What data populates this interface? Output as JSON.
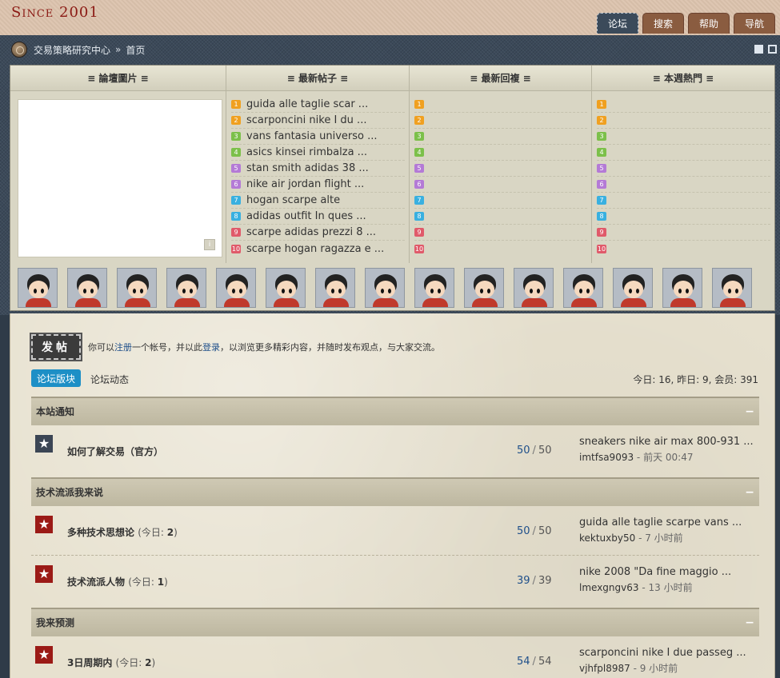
{
  "header": {
    "logo": "Since 2001",
    "nav": [
      "论坛",
      "搜索",
      "帮助",
      "导航"
    ]
  },
  "breadcrumb": {
    "site": "交易策略研究中心",
    "separator": "»",
    "current": "首页"
  },
  "panel": {
    "headers": {
      "pictures": "≡ 論壇圖片 ≡",
      "newest_posts": "≡ 最新帖子 ≡",
      "newest_replies": "≡ 最新回複 ≡",
      "weekly_hot": "≡ 本週熱門 ≡"
    },
    "newest_posts": [
      "guida alle taglie scar ...",
      "scarponcini nike I du ...",
      "vans fantasia universo ...",
      "asics kinsei rimbalza ...",
      "stan smith adidas 38 ...",
      "nike air jordan flight ...",
      "hogan scarpe alte",
      "adidas outfit In ques ...",
      "scarpe adidas prezzi 8 ...",
      "scarpe hogan ragazza e ..."
    ],
    "rank_numbers": [
      "1",
      "2",
      "3",
      "4",
      "5",
      "6",
      "7",
      "8",
      "9",
      "10"
    ],
    "rank_colors": [
      "#f0a020",
      "#f0a020",
      "#7cc04a",
      "#7cc04a",
      "#b47ad6",
      "#b47ad6",
      "#39b0e0",
      "#39b0e0",
      "#e05a6a",
      "#e05a6a"
    ],
    "avatar_count": 15
  },
  "forum": {
    "post_button": "发帖",
    "notice": {
      "part1": "你可以",
      "register": "注册",
      "part2": "一个帐号，并以此",
      "login": "登录",
      "part3": "，以浏览更多精彩内容，并随时发布观点，与大家交流。"
    },
    "tabs": [
      "论坛版块",
      "论坛动态"
    ],
    "stats": "今日: 16, 昨日: 9, 会员: 391",
    "sections": [
      {
        "title": "本站通知",
        "toggle": "−",
        "forums": [
          {
            "name": "如何了解交易（官方）",
            "today_label": "",
            "today_count": "",
            "threads": "50",
            "posts": "50",
            "last_title": "sneakers nike air max 800-931 ...",
            "last_user": "imtfsa9093",
            "last_time": "前天 00:47"
          }
        ]
      },
      {
        "title": "技术流派我来说",
        "toggle": "−",
        "forums": [
          {
            "name": "多种技术思想论",
            "today_label": "(今日: ",
            "today_count": "2",
            "threads": "50",
            "posts": "50",
            "last_title": "guida alle taglie scarpe vans ...",
            "last_user": "kektuxby50",
            "last_time": "7 小时前"
          },
          {
            "name": "技术流派人物",
            "today_label": "(今日: ",
            "today_count": "1",
            "threads": "39",
            "posts": "39",
            "last_title": "nike 2008 \"Da fine maggio ...",
            "last_user": "lmexgngv63",
            "last_time": "13 小时前"
          }
        ]
      },
      {
        "title": "我来预测",
        "toggle": "−",
        "forums": [
          {
            "name": "3日周期内",
            "today_label": "(今日: ",
            "today_count": "2",
            "threads": "54",
            "posts": "54",
            "last_title": "scarponcini nike I due passeg ...",
            "last_user": "vjhfpl8987",
            "last_time": "9 小时前"
          }
        ]
      }
    ]
  }
}
